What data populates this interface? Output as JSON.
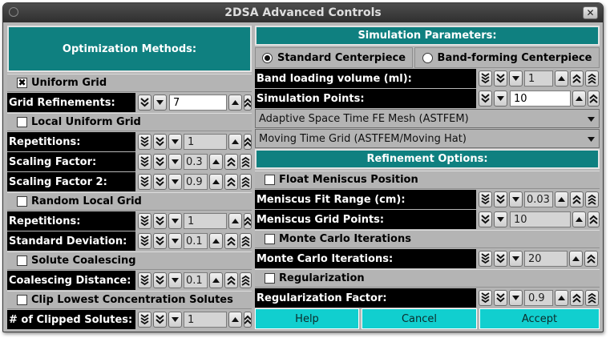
{
  "window": {
    "title": "2DSA Advanced Controls"
  },
  "left": {
    "header": "Optimization Methods:",
    "uniform_grid": {
      "label": "Uniform Grid",
      "checked": true
    },
    "grid_refinements": {
      "label": "Grid Refinements:",
      "value": "7"
    },
    "local_uniform_grid": {
      "label": "Local Uniform Grid",
      "checked": false
    },
    "lug_repetitions": {
      "label": "Repetitions:",
      "value": "1"
    },
    "scaling_factor": {
      "label": "Scaling Factor:",
      "value": "0.3"
    },
    "scaling_factor_2": {
      "label": "Scaling Factor 2:",
      "value": "0.9"
    },
    "random_local_grid": {
      "label": "Random Local Grid",
      "checked": false
    },
    "rlg_repetitions": {
      "label": "Repetitions:",
      "value": "1"
    },
    "standard_deviation": {
      "label": "Standard Deviation:",
      "value": "0.1"
    },
    "solute_coalescing": {
      "label": "Solute Coalescing",
      "checked": false
    },
    "coalescing_distance": {
      "label": "Coalescing Distance:",
      "value": "0.1"
    },
    "clip_lowest": {
      "label": "Clip Lowest Concentration Solutes",
      "checked": false
    },
    "clipped_solutes": {
      "label": "# of Clipped Solutes:",
      "value": "1"
    }
  },
  "right": {
    "sim_header": "Simulation Parameters:",
    "centerpiece": {
      "standard": {
        "label": "Standard Centerpiece",
        "selected": true
      },
      "band_forming": {
        "label": "Band-forming Centerpiece",
        "selected": false
      }
    },
    "band_loading": {
      "label": "Band loading volume (ml):",
      "value": "1"
    },
    "simulation_points": {
      "label": "Simulation Points:",
      "value": "10"
    },
    "mesh_combo": {
      "value": "Adaptive Space Time FE Mesh (ASTFEM)"
    },
    "grid_combo": {
      "value": "Moving Time Grid (ASTFEM/Moving Hat)"
    },
    "ref_header": "Refinement Options:",
    "float_meniscus": {
      "label": "Float Meniscus Position",
      "checked": false
    },
    "meniscus_fit_range": {
      "label": "Meniscus Fit Range (cm):",
      "value": "0.03"
    },
    "meniscus_grid_points": {
      "label": "Meniscus Grid Points:",
      "value": "10"
    },
    "monte_carlo_check": {
      "label": "Monte Carlo Iterations",
      "checked": false
    },
    "monte_carlo_iterations": {
      "label": "Monte Carlo Iterations:",
      "value": "20"
    },
    "regularization": {
      "label": "Regularization",
      "checked": false
    },
    "regularization_factor": {
      "label": "Regularization Factor:",
      "value": "0.9"
    }
  },
  "buttons": {
    "help": "Help",
    "cancel": "Cancel",
    "accept": "Accept"
  },
  "colors": {
    "teal": "#0f8080",
    "cyan_button": "#11cfcf",
    "label_bg": "#000000",
    "panel_bg": "#b4b4b4"
  },
  "icons": {
    "triple_down": "triple-chevron-down-icon",
    "double_down": "double-chevron-down-icon",
    "single_down": "triangle-down-icon",
    "single_up": "triangle-up-icon",
    "double_up": "double-chevron-up-icon",
    "triple_up": "triple-chevron-up-icon"
  }
}
